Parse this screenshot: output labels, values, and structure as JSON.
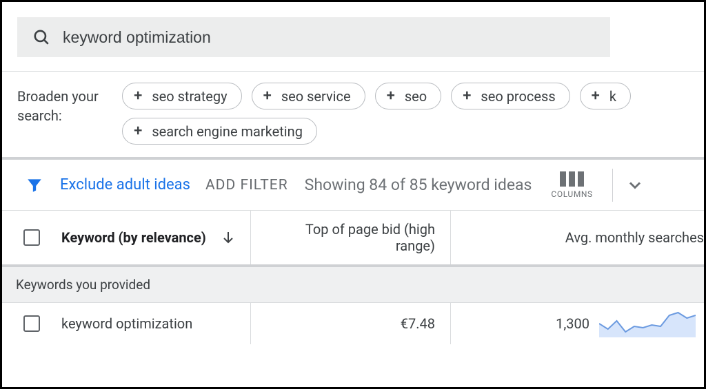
{
  "search": {
    "value": "keyword optimization"
  },
  "broaden": {
    "label": "Broaden your search:",
    "chips": [
      "seo strategy",
      "seo service",
      "seo",
      "seo process",
      "k",
      "search engine marketing"
    ]
  },
  "toolbar": {
    "exclude_label": "Exclude adult ideas",
    "add_filter": "ADD FILTER",
    "showing": "Showing 84 of 85 keyword ideas",
    "columns_label": "COLUMNS"
  },
  "table": {
    "headers": {
      "keyword": "Keyword (by relevance)",
      "bid": "Top of page bid (high range)",
      "searches": "Avg. monthly searches"
    },
    "section_label": "Keywords you provided",
    "rows": [
      {
        "keyword": "keyword optimization",
        "bid": "€7.48",
        "searches": "1,300"
      }
    ]
  },
  "chart_data": {
    "type": "line",
    "title": "",
    "xlabel": "",
    "ylabel": "",
    "x": [
      0,
      1,
      2,
      3,
      4,
      5,
      6,
      7,
      8,
      9,
      10,
      11
    ],
    "values": [
      1300,
      1100,
      1400,
      1000,
      1200,
      1150,
      1250,
      1200,
      1600,
      1700,
      1500,
      1600
    ],
    "ylim": [
      800,
      1800
    ]
  }
}
